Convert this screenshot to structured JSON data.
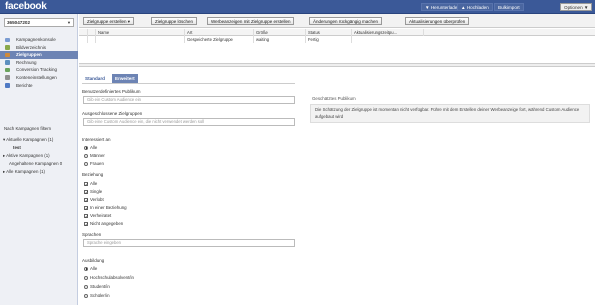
{
  "header": {
    "logo": "facebook",
    "buttons": [
      {
        "label": "▼ Herunterladen"
      },
      {
        "label": "▲ Hochladen"
      },
      {
        "label": "Bulkimport"
      },
      {
        "label": "Optionen ▼"
      }
    ]
  },
  "sidebar": {
    "account": "365047202",
    "nav": [
      {
        "label": "Kampagnenkonsole",
        "icon": "campaign-icon",
        "color": "#7a9bd1"
      },
      {
        "label": "Bildverzeichnis",
        "icon": "image-library-icon",
        "color": "#89a84a"
      },
      {
        "label": "Zielgruppen",
        "icon": "audience-icon",
        "color": "#d08a3b"
      },
      {
        "label": "Rechnung",
        "icon": "billing-icon",
        "color": "#5c8fbf"
      },
      {
        "label": "Conversion Tracking",
        "icon": "conversion-icon",
        "color": "#6aa35d"
      },
      {
        "label": "Konteneinstellungen",
        "icon": "settings-icon",
        "color": "#8f8f8f"
      },
      {
        "label": "Berichte",
        "icon": "reports-icon",
        "color": "#4f7ac4"
      }
    ],
    "filter_heading": "Nach Kampagnen filtern",
    "tree": [
      {
        "label": "▾ Aktuelle Kampagnen (1)"
      },
      {
        "label": "test"
      },
      {
        "label": "▸ Aktive Kampagnen (1)"
      },
      {
        "label": "Angehaltene Kampagnen 0"
      },
      {
        "label": "▸ Alle Kampagnen (1)"
      }
    ]
  },
  "toolbar": {
    "create": "Zielgruppe erstellen ▾",
    "delete": "Zielgruppe löschen",
    "create_ads": "Werbeanzeigen mit Zielgruppe erstellen",
    "undo": "Änderungen rückgängig machen",
    "check_updates": "Aktualisierungen überprüfen"
  },
  "table": {
    "columns": [
      "Name",
      "Art",
      "Größe",
      "Status",
      "Aktualisierungszeitpu..."
    ],
    "rows": [
      {
        "name": "",
        "type": "Gespeicherte Zielgruppe",
        "size": "waiting",
        "status": "Fertig",
        "updated": ""
      }
    ]
  },
  "tabs": {
    "standard": "Standard",
    "advanced": "Erweitert"
  },
  "form": {
    "name_label": "Benutzerdefiniertes Publikum",
    "name_placeholder": "Gib ein Custom Audience ein",
    "excluded_label": "Ausgeschlossene Zielgruppen",
    "excluded_placeholder": "Gib eine Custom Audience ein, die nicht verwendet werden soll",
    "interested_label": "Interessiert an",
    "interested_options": [
      {
        "label": "Alle",
        "selected": true
      },
      {
        "label": "Männer",
        "selected": false
      },
      {
        "label": "Frauen",
        "selected": false
      }
    ],
    "relationship_label": "Beziehung",
    "relationship_options": [
      {
        "label": "Alle",
        "checked": true
      },
      {
        "label": "Single",
        "checked": true
      },
      {
        "label": "Verlobt",
        "checked": true
      },
      {
        "label": "In einer Beziehung",
        "checked": true
      },
      {
        "label": "Verheiratet",
        "checked": true
      },
      {
        "label": "Nicht angegeben",
        "checked": true
      }
    ],
    "languages_label": "Sprachen",
    "languages_placeholder": "Sprache eingeben",
    "education_label": "Ausbildung",
    "education_options": [
      {
        "label": "Alle",
        "selected": true
      },
      {
        "label": "Hochschulabsolvent/in",
        "selected": false
      },
      {
        "label": "Student/in",
        "selected": false
      },
      {
        "label": "Schüler/in",
        "selected": false
      }
    ]
  },
  "estimate": {
    "heading": "Geschätztes Publikum",
    "message": "Die Schätzung der Zielgruppe ist momentan nicht verfügbar. Führe mit dem Erstellen deiner Werbeanzeige fort, während Custom Audience aufgebaut wird"
  }
}
